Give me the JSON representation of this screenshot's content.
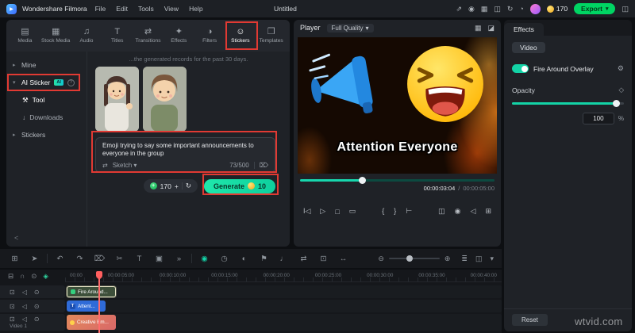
{
  "titlebar": {
    "app_name": "Wondershare Filmora",
    "menus": [
      "File",
      "Edit",
      "Tools",
      "View",
      "Help"
    ],
    "project_title": "Untitled",
    "coin_count": "170",
    "export_label": "Export"
  },
  "icons": {
    "logo": "▶",
    "share": "⇗",
    "record": "◉",
    "grid": "▦",
    "panels": "◫",
    "sync": "↻",
    "bell": "◔",
    "chevron_down": "▾",
    "chevron_right": "▸",
    "collapse_left": "<",
    "help": "?",
    "ai_tool": "⚒",
    "download": "↓",
    "shuffle": "⇄",
    "trash": "⌦",
    "refresh": "↻",
    "plus": "+",
    "scopes": "◪",
    "text_tool": "T",
    "step_back": "I◁",
    "play": "▷",
    "stop": "□",
    "frame": "▭",
    "mark_in": "{",
    "mark_out": "}",
    "marker": "⊢",
    "mirror": "◫",
    "snapshot": "◉",
    "speaker": "◁",
    "detach": "⊞",
    "gear": "⚙",
    "keyframe": "◇",
    "zoom_out": "⊖",
    "zoom_in": "⊕",
    "track_rows": "≣",
    "layout": "◫",
    "caret_down": "▾",
    "toolbar": [
      "⊞",
      "➤",
      "↶",
      "↷",
      "⌦",
      "✂",
      "T",
      "▣",
      "»",
      "◉",
      "◷",
      "◐",
      "⚑",
      "♩",
      "⇄",
      "⊡",
      "↔"
    ],
    "corner": [
      "⊟",
      "∩",
      "⊙",
      "◈"
    ],
    "track": [
      "⊡",
      "◁",
      "⊙"
    ]
  },
  "tabs": [
    {
      "label": "Media",
      "icon": "▤"
    },
    {
      "label": "Stock Media",
      "icon": "▦"
    },
    {
      "label": "Audio",
      "icon": "♫"
    },
    {
      "label": "Titles",
      "icon": "T"
    },
    {
      "label": "Transitions",
      "icon": "⇄"
    },
    {
      "label": "Effects",
      "icon": "✦"
    },
    {
      "label": "Filters",
      "icon": "◑"
    },
    {
      "label": "Stickers",
      "icon": "☺"
    },
    {
      "label": "Templates",
      "icon": "❒"
    }
  ],
  "sidebar": {
    "items": [
      {
        "label": "Mine"
      },
      {
        "label": "AI Sticker",
        "badge": "AI"
      },
      {
        "label": "Tool"
      },
      {
        "label": "Downloads"
      },
      {
        "label": "Stickers"
      }
    ]
  },
  "ai_panel": {
    "history_note": "...the generated records for the past 30 days.",
    "prompt": "Emoji trying to say some important announcements to everyone in the group",
    "style_label": "Sketch",
    "char_count": "73/500",
    "credit_count": "170",
    "generate_label": "Generate",
    "generate_cost": "10"
  },
  "player": {
    "label": "Player",
    "quality": "Full Quality",
    "overlay_text": "Attention Everyone",
    "current_time": "00:00:03:04",
    "time_separator": "/",
    "total_time": "00:00:05:00"
  },
  "effects_panel": {
    "tab_label": "Effects",
    "subtab_label": "Video",
    "toggle_label": "Fire Around Overlay",
    "opacity_label": "Opacity",
    "opacity_value": "100",
    "opacity_unit": "%",
    "reset_label": "Reset"
  },
  "timeline": {
    "ruler": [
      "00:00",
      "00:00:05:00",
      "00:00:10:00",
      "00:00:15:00",
      "00:00:20:00",
      "00:00:25:00",
      "00:00:30:00",
      "00:00:35:00",
      "00:00:40:00"
    ],
    "clips": [
      {
        "label": "Fire Around..."
      },
      {
        "label": "Attent..."
      },
      {
        "label": "Creative Em..."
      }
    ],
    "track_label": "Video 1"
  },
  "watermark": "wtvid.com",
  "colors": {
    "accent_teal": "#13d3a6",
    "export_green": "#00d563",
    "annotation_red": "#e13a33"
  }
}
